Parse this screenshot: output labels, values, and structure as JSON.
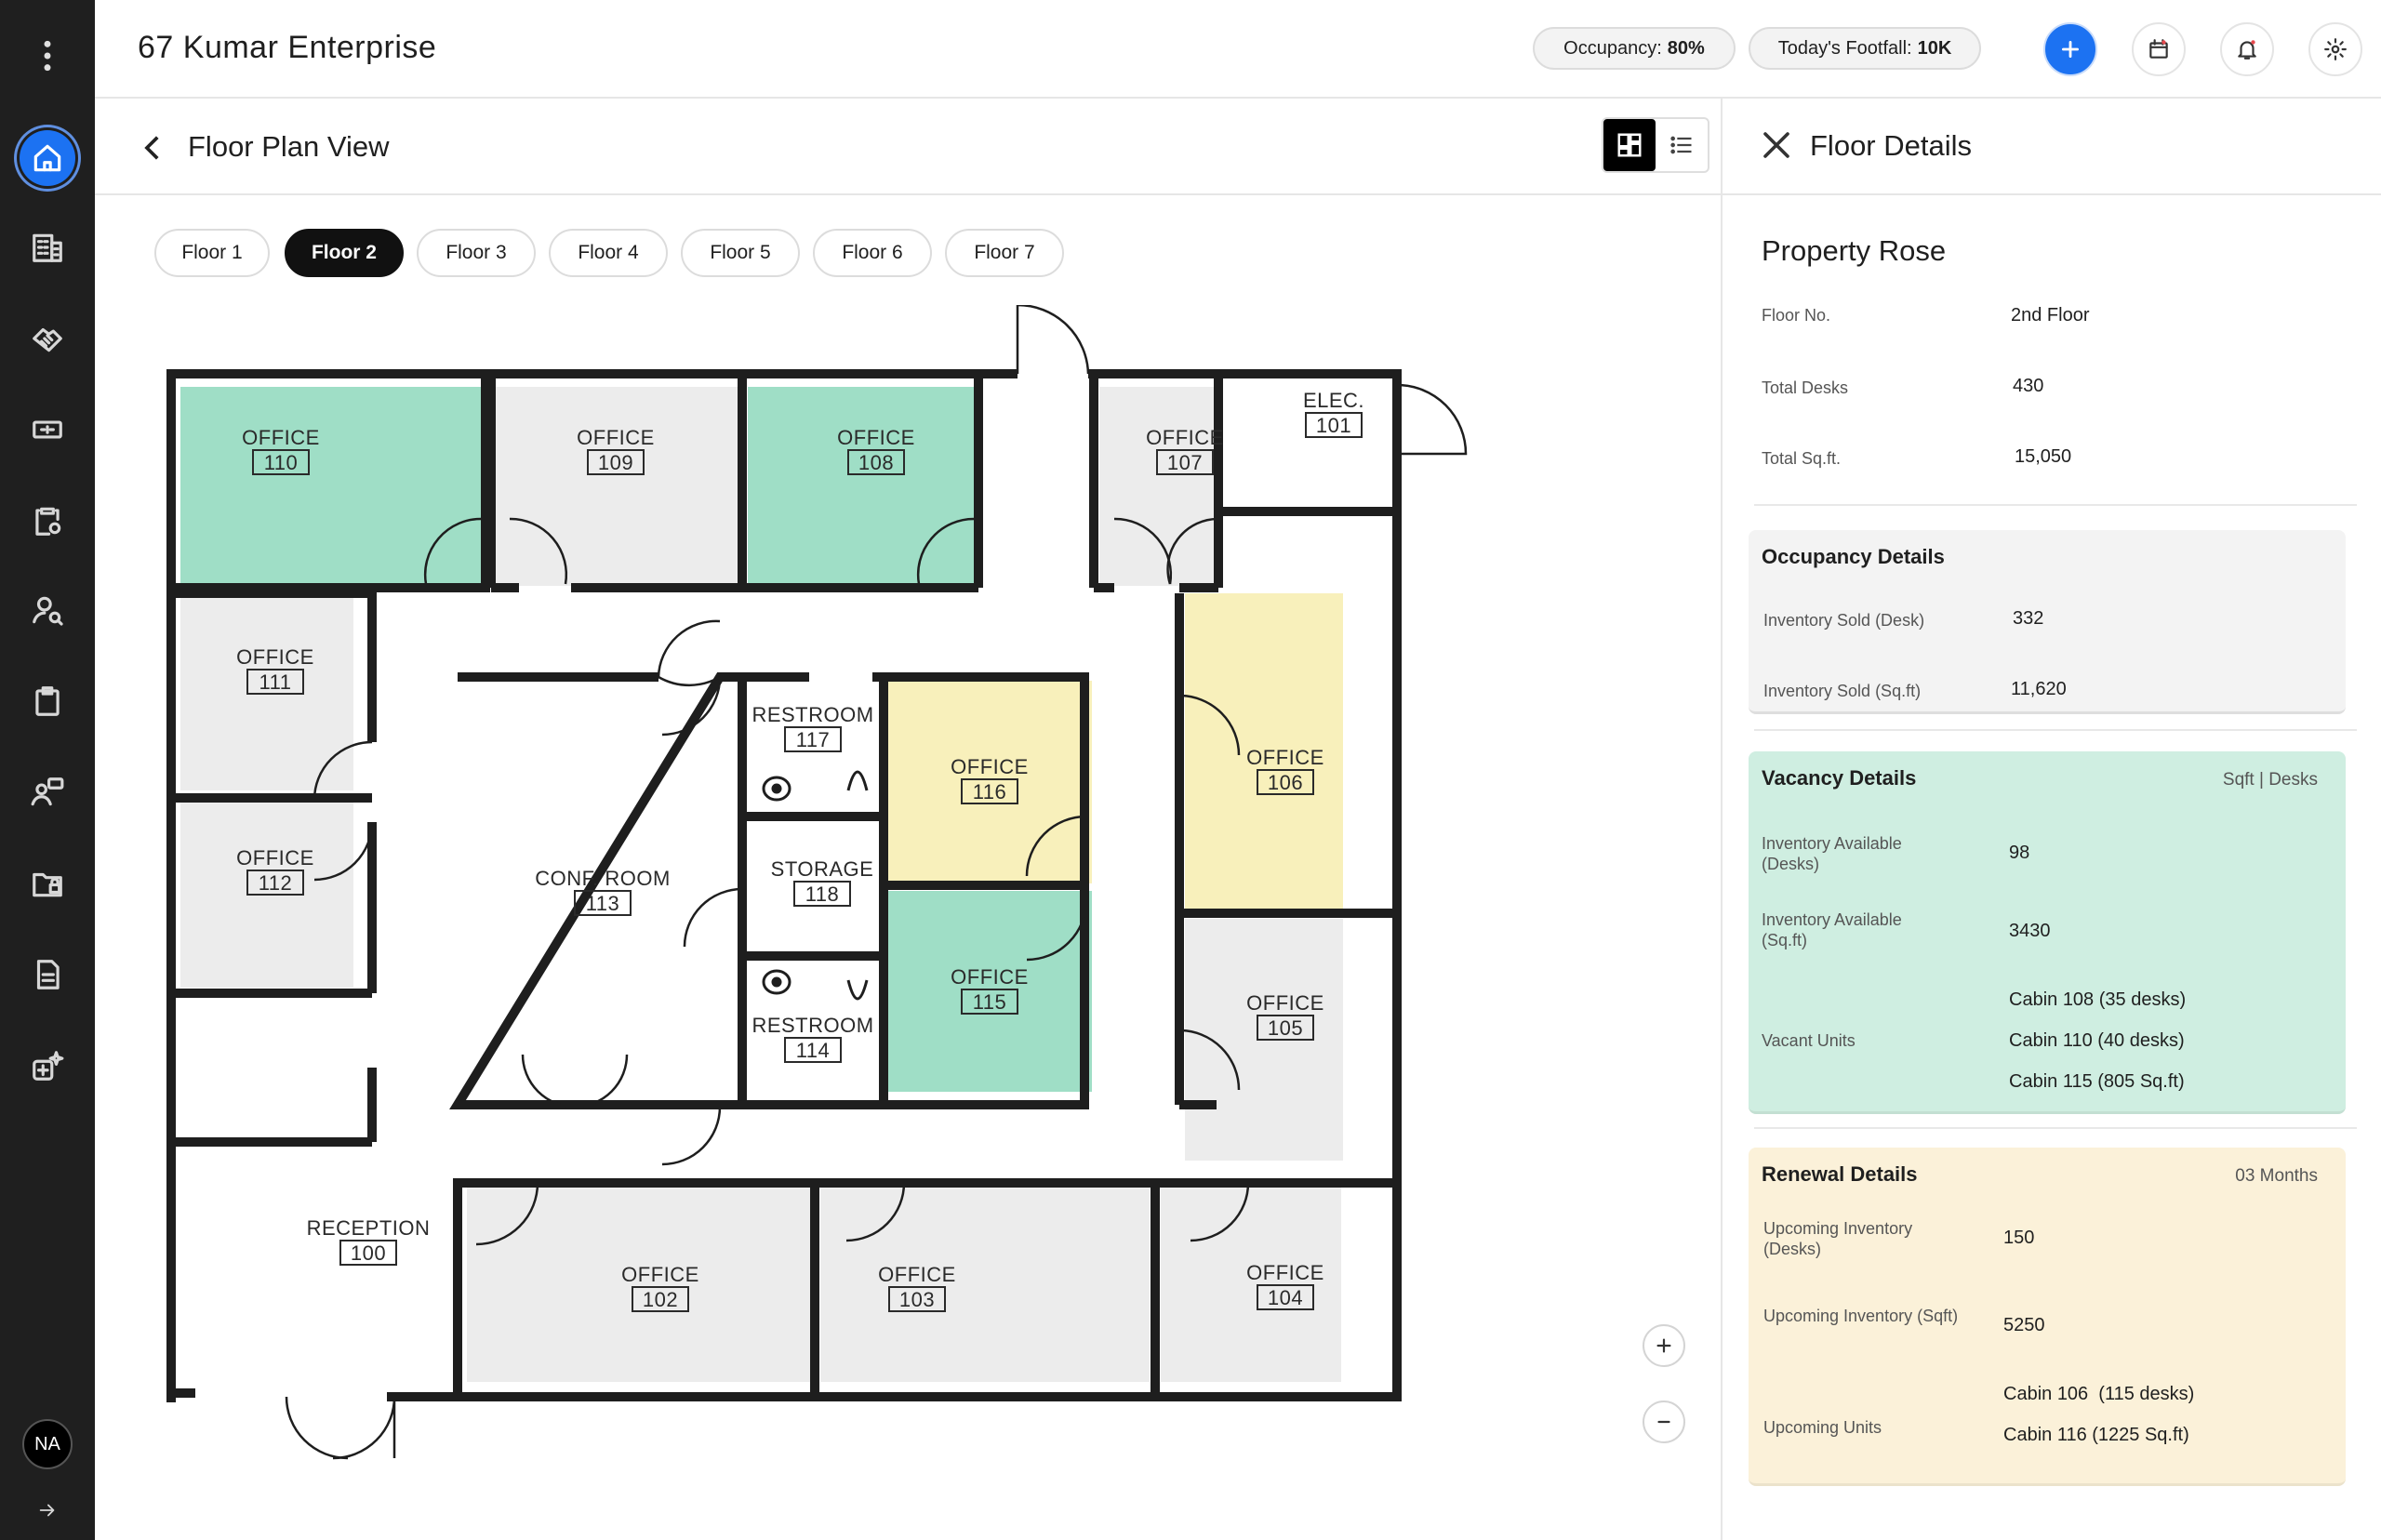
{
  "app": {
    "title": "67 Kumar Enterprise",
    "accent_color": "#1c72f2"
  },
  "topbar": {
    "occupancy_label": "Occupancy:",
    "occupancy_value": "80%",
    "footfall_label": "Today's Footfall:",
    "footfall_value": "10K",
    "icons": [
      "plus-icon",
      "calendar-icon",
      "bell-icon",
      "gear-icon"
    ]
  },
  "rail": {
    "icons": [
      "menu-dots-icon",
      "home-icon",
      "building-icon",
      "handshake-icon",
      "ticket-icon",
      "clipboard-gear-icon",
      "user-search-icon",
      "clipboard-icon",
      "user-chat-icon",
      "folder-lock-icon",
      "document-icon",
      "ai-sparkle-icon",
      "arrow-right-icon"
    ],
    "avatar_initials": "NA"
  },
  "page": {
    "title": "Floor Plan View",
    "view_modes": [
      "grid-view-icon",
      "list-view-icon"
    ]
  },
  "floors": {
    "tabs": [
      "Floor 1",
      "Floor 2",
      "Floor 3",
      "Floor 4",
      "Floor 5",
      "Floor 6",
      "Floor 7"
    ],
    "active_index": 1
  },
  "plan": {
    "colors": {
      "vacant": "#9fdec6",
      "renewal": "#f8f0bb",
      "occupied": "#ececec"
    },
    "rooms": [
      {
        "name": "OFFICE",
        "num": "110",
        "status": "vacant"
      },
      {
        "name": "OFFICE",
        "num": "109",
        "status": "occupied"
      },
      {
        "name": "OFFICE",
        "num": "108",
        "status": "vacant"
      },
      {
        "name": "OFFICE",
        "num": "107",
        "status": "occupied"
      },
      {
        "name": "ELEC.",
        "num": "101",
        "status": "none"
      },
      {
        "name": "OFFICE",
        "num": "111",
        "status": "occupied"
      },
      {
        "name": "OFFICE",
        "num": "112",
        "status": "occupied"
      },
      {
        "name": "CONF. ROOM",
        "num": "113",
        "status": "none"
      },
      {
        "name": "RESTROOM",
        "num": "117",
        "status": "none"
      },
      {
        "name": "STORAGE",
        "num": "118",
        "status": "none"
      },
      {
        "name": "RESTROOM",
        "num": "114",
        "status": "none"
      },
      {
        "name": "OFFICE",
        "num": "116",
        "status": "renewal"
      },
      {
        "name": "OFFICE",
        "num": "115",
        "status": "vacant"
      },
      {
        "name": "OFFICE",
        "num": "106",
        "status": "renewal"
      },
      {
        "name": "OFFICE",
        "num": "105",
        "status": "occupied"
      },
      {
        "name": "RECEPTION",
        "num": "100",
        "status": "none"
      },
      {
        "name": "OFFICE",
        "num": "102",
        "status": "occupied"
      },
      {
        "name": "OFFICE",
        "num": "103",
        "status": "occupied"
      },
      {
        "name": "OFFICE",
        "num": "104",
        "status": "occupied"
      }
    ]
  },
  "panel": {
    "title": "Floor Details",
    "property_name": "Property Rose",
    "summary": [
      {
        "label": "Floor No.",
        "value": "2nd Floor"
      },
      {
        "label": "Total Desks",
        "value": "430"
      },
      {
        "label": "Total Sq.ft.",
        "value": "15,050"
      }
    ],
    "occupancy": {
      "title": "Occupancy Details",
      "rows": [
        {
          "label": "Inventory Sold (Desk)",
          "value": "332"
        },
        {
          "label": "Inventory Sold (Sq.ft)",
          "value": "11,620"
        }
      ]
    },
    "vacancy": {
      "title": "Vacancy Details",
      "aside": "Sqft | Desks",
      "rows": [
        {
          "label": "Inventory Available (Desks)",
          "value": "98"
        },
        {
          "label": "Inventory Available (Sq.ft)",
          "value": "3430"
        }
      ],
      "units_label": "Vacant Units",
      "units": [
        "Cabin 108 (35 desks)",
        "Cabin 110 (40 desks)",
        "Cabin 115 (805 Sq.ft)"
      ]
    },
    "renewal": {
      "title": "Renewal Details",
      "aside": "03 Months",
      "rows": [
        {
          "label": "Upcoming Inventory (Desks)",
          "value": "150"
        },
        {
          "label": "Upcoming Inventory (Sqft)",
          "value": "5250"
        }
      ],
      "units_label": "Upcoming Units",
      "units": [
        "Cabin 106  (115 desks)",
        "Cabin 116 (1225 Sq.ft)"
      ]
    }
  }
}
